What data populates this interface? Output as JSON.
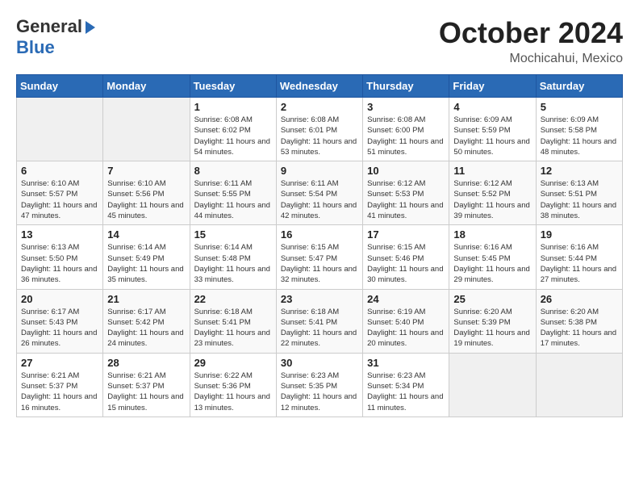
{
  "logo": {
    "general": "General",
    "blue": "Blue"
  },
  "header": {
    "month": "October 2024",
    "location": "Mochicahui, Mexico"
  },
  "weekdays": [
    "Sunday",
    "Monday",
    "Tuesday",
    "Wednesday",
    "Thursday",
    "Friday",
    "Saturday"
  ],
  "weeks": [
    [
      {
        "day": "",
        "info": ""
      },
      {
        "day": "",
        "info": ""
      },
      {
        "day": "1",
        "info": "Sunrise: 6:08 AM\nSunset: 6:02 PM\nDaylight: 11 hours and 54 minutes."
      },
      {
        "day": "2",
        "info": "Sunrise: 6:08 AM\nSunset: 6:01 PM\nDaylight: 11 hours and 53 minutes."
      },
      {
        "day": "3",
        "info": "Sunrise: 6:08 AM\nSunset: 6:00 PM\nDaylight: 11 hours and 51 minutes."
      },
      {
        "day": "4",
        "info": "Sunrise: 6:09 AM\nSunset: 5:59 PM\nDaylight: 11 hours and 50 minutes."
      },
      {
        "day": "5",
        "info": "Sunrise: 6:09 AM\nSunset: 5:58 PM\nDaylight: 11 hours and 48 minutes."
      }
    ],
    [
      {
        "day": "6",
        "info": "Sunrise: 6:10 AM\nSunset: 5:57 PM\nDaylight: 11 hours and 47 minutes."
      },
      {
        "day": "7",
        "info": "Sunrise: 6:10 AM\nSunset: 5:56 PM\nDaylight: 11 hours and 45 minutes."
      },
      {
        "day": "8",
        "info": "Sunrise: 6:11 AM\nSunset: 5:55 PM\nDaylight: 11 hours and 44 minutes."
      },
      {
        "day": "9",
        "info": "Sunrise: 6:11 AM\nSunset: 5:54 PM\nDaylight: 11 hours and 42 minutes."
      },
      {
        "day": "10",
        "info": "Sunrise: 6:12 AM\nSunset: 5:53 PM\nDaylight: 11 hours and 41 minutes."
      },
      {
        "day": "11",
        "info": "Sunrise: 6:12 AM\nSunset: 5:52 PM\nDaylight: 11 hours and 39 minutes."
      },
      {
        "day": "12",
        "info": "Sunrise: 6:13 AM\nSunset: 5:51 PM\nDaylight: 11 hours and 38 minutes."
      }
    ],
    [
      {
        "day": "13",
        "info": "Sunrise: 6:13 AM\nSunset: 5:50 PM\nDaylight: 11 hours and 36 minutes."
      },
      {
        "day": "14",
        "info": "Sunrise: 6:14 AM\nSunset: 5:49 PM\nDaylight: 11 hours and 35 minutes."
      },
      {
        "day": "15",
        "info": "Sunrise: 6:14 AM\nSunset: 5:48 PM\nDaylight: 11 hours and 33 minutes."
      },
      {
        "day": "16",
        "info": "Sunrise: 6:15 AM\nSunset: 5:47 PM\nDaylight: 11 hours and 32 minutes."
      },
      {
        "day": "17",
        "info": "Sunrise: 6:15 AM\nSunset: 5:46 PM\nDaylight: 11 hours and 30 minutes."
      },
      {
        "day": "18",
        "info": "Sunrise: 6:16 AM\nSunset: 5:45 PM\nDaylight: 11 hours and 29 minutes."
      },
      {
        "day": "19",
        "info": "Sunrise: 6:16 AM\nSunset: 5:44 PM\nDaylight: 11 hours and 27 minutes."
      }
    ],
    [
      {
        "day": "20",
        "info": "Sunrise: 6:17 AM\nSunset: 5:43 PM\nDaylight: 11 hours and 26 minutes."
      },
      {
        "day": "21",
        "info": "Sunrise: 6:17 AM\nSunset: 5:42 PM\nDaylight: 11 hours and 24 minutes."
      },
      {
        "day": "22",
        "info": "Sunrise: 6:18 AM\nSunset: 5:41 PM\nDaylight: 11 hours and 23 minutes."
      },
      {
        "day": "23",
        "info": "Sunrise: 6:18 AM\nSunset: 5:41 PM\nDaylight: 11 hours and 22 minutes."
      },
      {
        "day": "24",
        "info": "Sunrise: 6:19 AM\nSunset: 5:40 PM\nDaylight: 11 hours and 20 minutes."
      },
      {
        "day": "25",
        "info": "Sunrise: 6:20 AM\nSunset: 5:39 PM\nDaylight: 11 hours and 19 minutes."
      },
      {
        "day": "26",
        "info": "Sunrise: 6:20 AM\nSunset: 5:38 PM\nDaylight: 11 hours and 17 minutes."
      }
    ],
    [
      {
        "day": "27",
        "info": "Sunrise: 6:21 AM\nSunset: 5:37 PM\nDaylight: 11 hours and 16 minutes."
      },
      {
        "day": "28",
        "info": "Sunrise: 6:21 AM\nSunset: 5:37 PM\nDaylight: 11 hours and 15 minutes."
      },
      {
        "day": "29",
        "info": "Sunrise: 6:22 AM\nSunset: 5:36 PM\nDaylight: 11 hours and 13 minutes."
      },
      {
        "day": "30",
        "info": "Sunrise: 6:23 AM\nSunset: 5:35 PM\nDaylight: 11 hours and 12 minutes."
      },
      {
        "day": "31",
        "info": "Sunrise: 6:23 AM\nSunset: 5:34 PM\nDaylight: 11 hours and 11 minutes."
      },
      {
        "day": "",
        "info": ""
      },
      {
        "day": "",
        "info": ""
      }
    ]
  ]
}
